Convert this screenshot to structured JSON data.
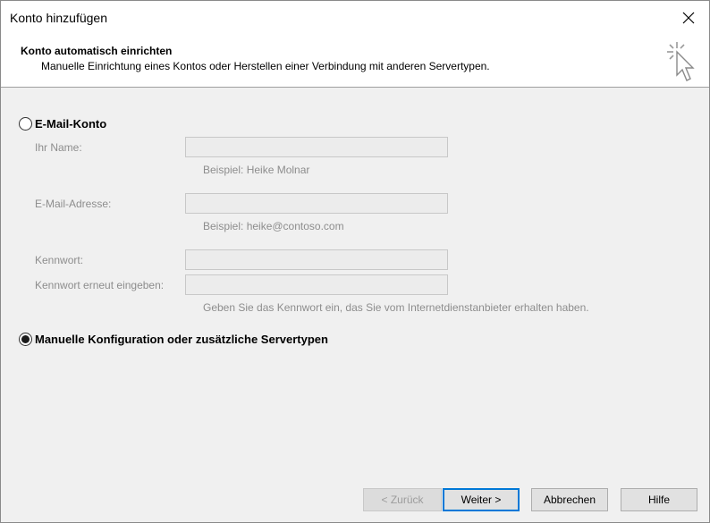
{
  "window": {
    "title": "Konto hinzufügen",
    "close_icon": "close-icon"
  },
  "header": {
    "title": "Konto automatisch einrichten",
    "description": "Manuelle Einrichtung eines Kontos oder Herstellen einer Verbindung mit anderen Servertypen.",
    "icon": "cursor-click-icon"
  },
  "email_option": {
    "label": "E-Mail-Konto",
    "selected": false,
    "fields": {
      "name_label": "Ihr Name:",
      "name_value": "",
      "name_hint": "Beispiel: Heike Molnar",
      "email_label": "E-Mail-Adresse:",
      "email_value": "",
      "email_hint": "Beispiel: heike@contoso.com",
      "password_label": "Kennwort:",
      "password_value": "",
      "password_repeat_label": "Kennwort erneut eingeben:",
      "password_repeat_value": "",
      "password_hint": "Geben Sie das Kennwort ein, das Sie vom Internetdienstanbieter erhalten haben."
    }
  },
  "manual_option": {
    "label": "Manuelle Konfiguration oder zusätzliche Servertypen",
    "selected": true
  },
  "buttons": {
    "back": "< Zurück",
    "next": "Weiter >",
    "cancel": "Abbrechen",
    "help": "Hilfe"
  },
  "colors": {
    "focus_border": "#0078d7",
    "dialog_bg": "#f0f0f0",
    "disabled_text": "#8d8d8d"
  }
}
